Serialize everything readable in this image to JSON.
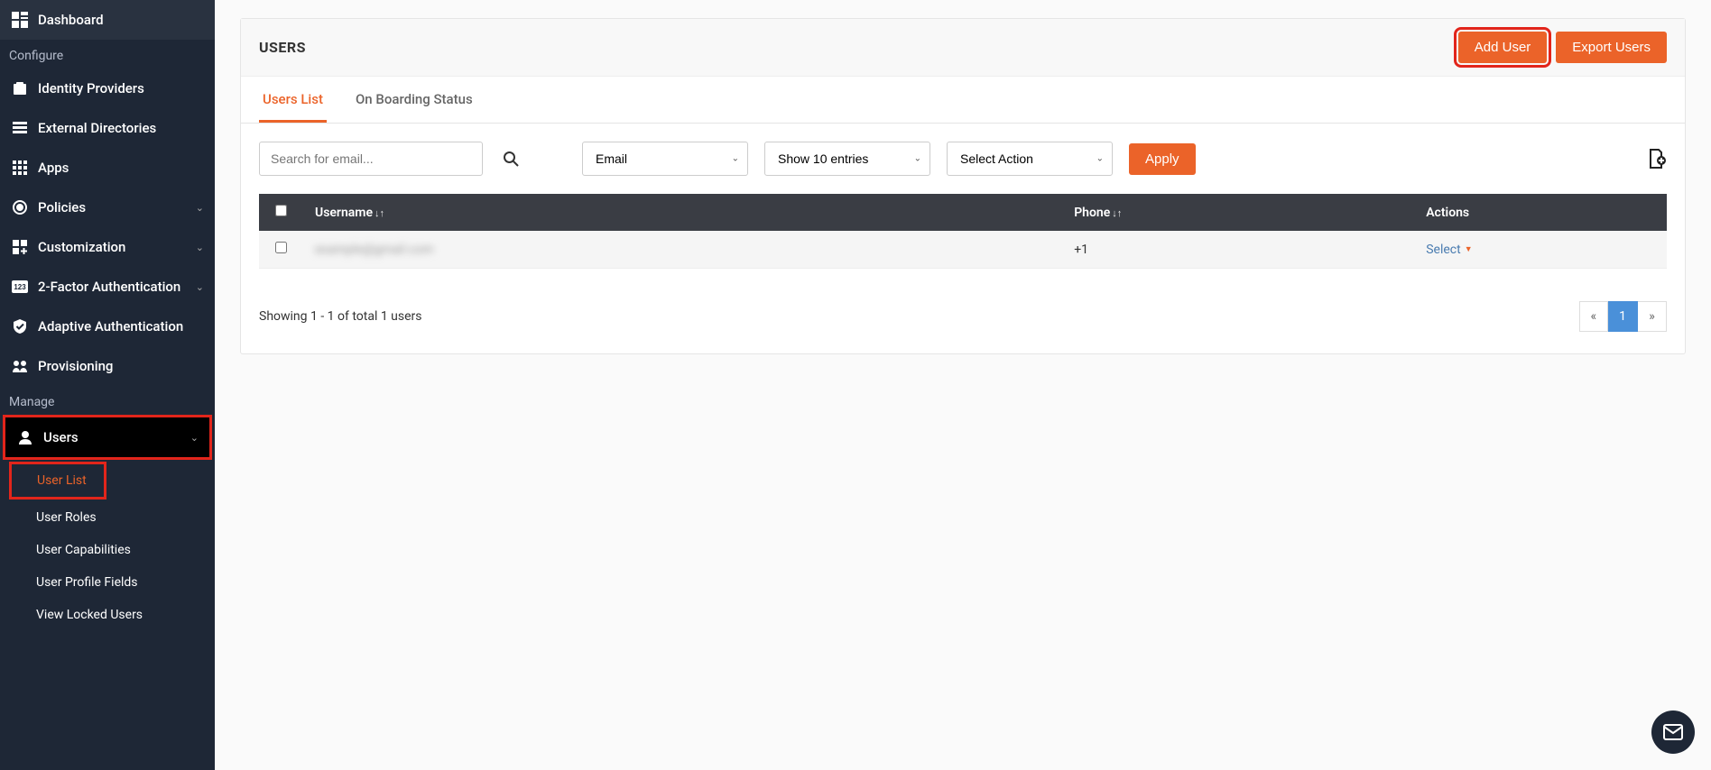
{
  "sidebar": {
    "items": [
      {
        "label": "Dashboard",
        "icon": "dashboard"
      }
    ],
    "sections": [
      {
        "heading": "Configure",
        "items": [
          {
            "label": "Identity Providers",
            "icon": "identity",
            "expandable": false
          },
          {
            "label": "External Directories",
            "icon": "directories",
            "expandable": false
          },
          {
            "label": "Apps",
            "icon": "apps",
            "expandable": false
          },
          {
            "label": "Policies",
            "icon": "policies",
            "expandable": true
          },
          {
            "label": "Customization",
            "icon": "customization",
            "expandable": true
          },
          {
            "label": "2-Factor Authentication",
            "icon": "2fa",
            "expandable": true
          },
          {
            "label": "Adaptive Authentication",
            "icon": "adaptive",
            "expandable": false
          },
          {
            "label": "Provisioning",
            "icon": "provisioning",
            "expandable": false
          }
        ]
      },
      {
        "heading": "Manage",
        "items": [
          {
            "label": "Users",
            "icon": "users",
            "expandable": true,
            "active": true,
            "sub": [
              {
                "label": "User List",
                "active": true
              },
              {
                "label": "User Roles"
              },
              {
                "label": "User Capabilities"
              },
              {
                "label": "User Profile Fields"
              },
              {
                "label": "View Locked Users"
              }
            ]
          }
        ]
      }
    ]
  },
  "page": {
    "title": "USERS",
    "add_btn": "Add User",
    "export_btn": "Export Users",
    "tabs": [
      {
        "label": "Users List",
        "active": true
      },
      {
        "label": "On Boarding Status"
      }
    ]
  },
  "toolbar": {
    "search_placeholder": "Search for email...",
    "field_select": "Email",
    "entries_select": "Show 10 entries",
    "action_select": "Select Action",
    "apply_btn": "Apply"
  },
  "table": {
    "headers": {
      "username": "Username",
      "phone": "Phone",
      "actions": "Actions"
    },
    "rows": [
      {
        "username": "example@gmail.com",
        "phone": "+1",
        "action_label": "Select"
      }
    ],
    "footer_text": "Showing 1 - 1 of total 1 users",
    "pagination": {
      "prev": "«",
      "current": "1",
      "next": "»"
    }
  }
}
